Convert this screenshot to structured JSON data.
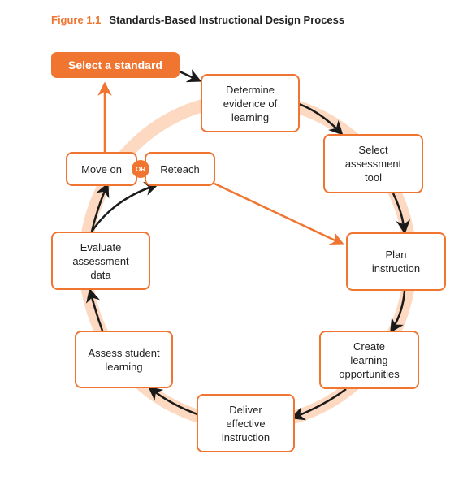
{
  "figure": {
    "label": "Figure 1.1",
    "title": "Standards-Based Instructional Design Process"
  },
  "colors": {
    "accent": "#f07530",
    "ring": "#fcd9c0",
    "arrow": "#1a1a1a",
    "text": "#222222"
  },
  "nodes": {
    "start": "Select a standard",
    "determine": "Determine\nevidence of\nlearning",
    "select_tool": "Select\nassessment\ntool",
    "plan": "Plan\ninstruction",
    "create": "Create\nlearning\nopportunities",
    "deliver": "Deliver\neffective\ninstruction",
    "assess": "Assess student\nlearning",
    "evaluate": "Evaluate\nassessment\ndata",
    "move_on": "Move on",
    "reteach": "Reteach",
    "or": "OR"
  },
  "edges": [
    {
      "from": "start",
      "to": "determine",
      "style": "black"
    },
    {
      "from": "determine",
      "to": "select_tool",
      "style": "black"
    },
    {
      "from": "select_tool",
      "to": "plan",
      "style": "black"
    },
    {
      "from": "plan",
      "to": "create",
      "style": "black"
    },
    {
      "from": "create",
      "to": "deliver",
      "style": "black"
    },
    {
      "from": "deliver",
      "to": "assess",
      "style": "black"
    },
    {
      "from": "assess",
      "to": "evaluate",
      "style": "black"
    },
    {
      "from": "evaluate",
      "to": "move_on",
      "style": "black"
    },
    {
      "from": "evaluate",
      "to": "reteach",
      "style": "black"
    },
    {
      "from": "move_on",
      "to": "start",
      "style": "orange"
    },
    {
      "from": "reteach",
      "to": "plan",
      "style": "orange"
    }
  ]
}
